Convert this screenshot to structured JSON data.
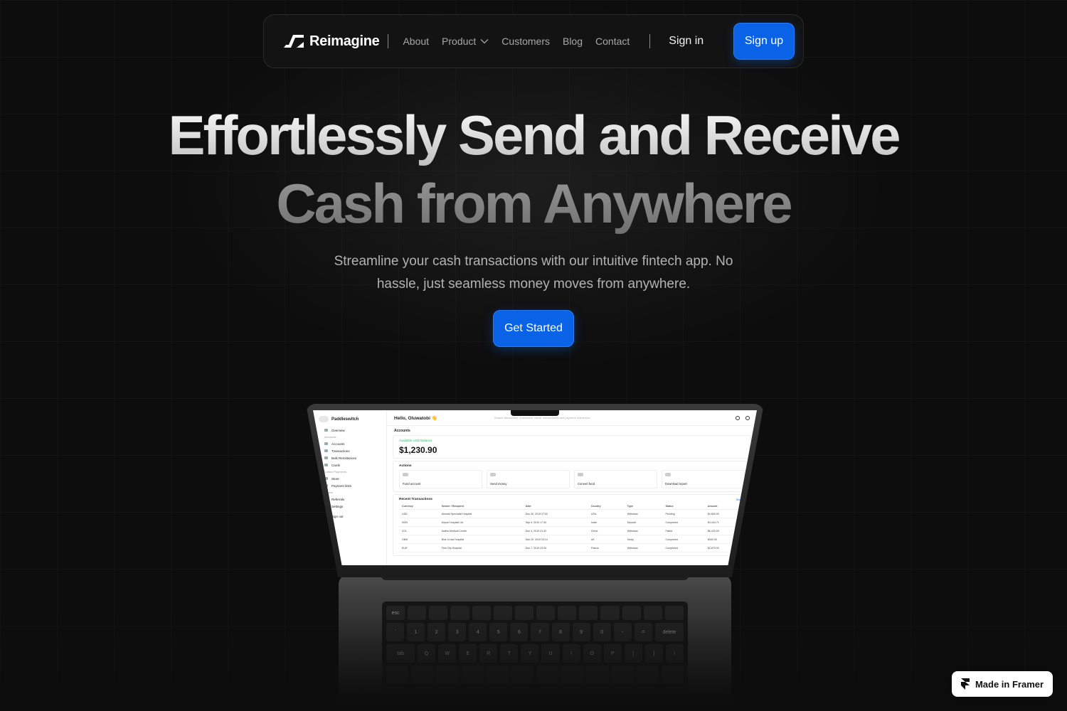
{
  "nav": {
    "brand": "Reimagine",
    "links": [
      "About",
      "Product",
      "Customers",
      "Blog",
      "Contact"
    ],
    "signin": "Sign in",
    "signup": "Sign up"
  },
  "hero": {
    "line1": "Effortlessly Send and Receive",
    "line2": "Cash from Anywhere",
    "subtitle": "Streamline your cash transactions with our intuitive fintech app. No hassle, just seamless money moves from anywhere.",
    "cta": "Get Started"
  },
  "dashboard": {
    "workspace": "Paddleswitch",
    "greeting": "Hello, Oluwatobi 👋",
    "search_placeholder": "Search transaction, customers, cards, subaccounts and payment references",
    "sidebar": {
      "overview": "Overview",
      "accounts_group": "Accounts",
      "items": [
        "Accounts",
        "Transactions",
        "Bulk Remittances",
        "Cards"
      ],
      "payments_group": "Collect Payments",
      "payment_items": [
        "Store",
        "Payment links"
      ],
      "others_group": "Others",
      "other_items": [
        "Referrals",
        "Settings"
      ],
      "signout": "Sign out"
    },
    "accounts_title": "Accounts",
    "balance_label": "Available USD Balance",
    "balance": "$1,230.90",
    "actions_title": "Actions",
    "actions": [
      "Fund account",
      "Send money",
      "Convert fund",
      "Download report"
    ],
    "recent_title": "Recent Transactions",
    "see_all": "See all",
    "columns": [
      "Currency",
      "Sender / Recipient",
      "Date",
      "Country",
      "Type",
      "Status",
      "Amount"
    ],
    "rows": [
      [
        "USD",
        "Ahmadi Specialist Hospital",
        "Dec 30, 2019 07:52",
        "USA",
        "Withdraw",
        "Pending",
        "$4,800.90"
      ],
      [
        "NGN",
        "Airport Hospital Ltd",
        "Sep 4, 2019 17:30",
        "India",
        "Deposit",
        "Completed",
        "$3,444.71"
      ],
      [
        "ZOL",
        "Arabia Medical Centre",
        "Dec 4, 2019 21:42",
        "China",
        "Withdraw",
        "Failed",
        "$6,420.00"
      ],
      [
        "GBM",
        "Blue Cross Hospital",
        "Mar 20, 2019 23:14",
        "UK",
        "Swap",
        "Completed",
        "$540.00"
      ],
      [
        "EUR",
        "First City Hospital",
        "Dec 7, 2019 23:26",
        "France",
        "Withdraw",
        "Completed",
        "$2,879.90"
      ]
    ]
  },
  "keyboard": {
    "esc": "esc",
    "delete": "delete",
    "numbers": [
      "`",
      "1",
      "2",
      "3",
      "4",
      "5",
      "6",
      "7",
      "8",
      "9",
      "0",
      "-",
      "="
    ],
    "tab": "tab",
    "letters": [
      "Q",
      "W",
      "E",
      "R",
      "T",
      "Y",
      "U",
      "I",
      "O",
      "P",
      "[",
      "]",
      "\\"
    ]
  },
  "badge": "Made in Framer",
  "colors": {
    "accent": "#0a63e6",
    "background": "#0d0d0d"
  }
}
